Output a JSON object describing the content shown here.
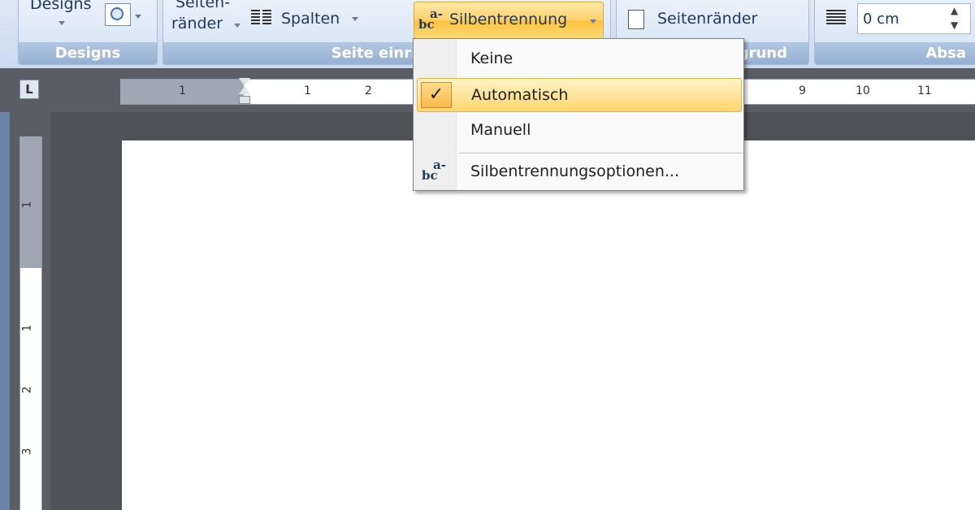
{
  "ribbon": {
    "designs_label": "Designs",
    "designs_group": "Designs",
    "seiten_label_1": "Seiten-",
    "seiten_label_2": "ränder",
    "spalten_label": "Spalten",
    "silbentrennung_label": "Silbentrennung",
    "seite_einrichten_group": "Seite einricht",
    "hintergrund_group": "grund",
    "seitenraender_label": "Seitenränder",
    "indent_value": "0 cm",
    "absatz_group": "Absa"
  },
  "ruler": {
    "ticks": [
      "1",
      "1",
      "2",
      "9",
      "10",
      "11"
    ],
    "vticks": [
      "1",
      "1",
      "2",
      "3"
    ]
  },
  "menu": {
    "items": [
      {
        "label": "Keine",
        "selected": false
      },
      {
        "label": "Automatisch",
        "selected": true
      },
      {
        "label": "Manuell",
        "selected": false
      },
      {
        "label": "Silbentrennungsoptionen...",
        "selected": false
      }
    ],
    "check_glyph": "✓",
    "hyph_icon_top": "a-",
    "hyph_icon_bottom": "bc"
  }
}
